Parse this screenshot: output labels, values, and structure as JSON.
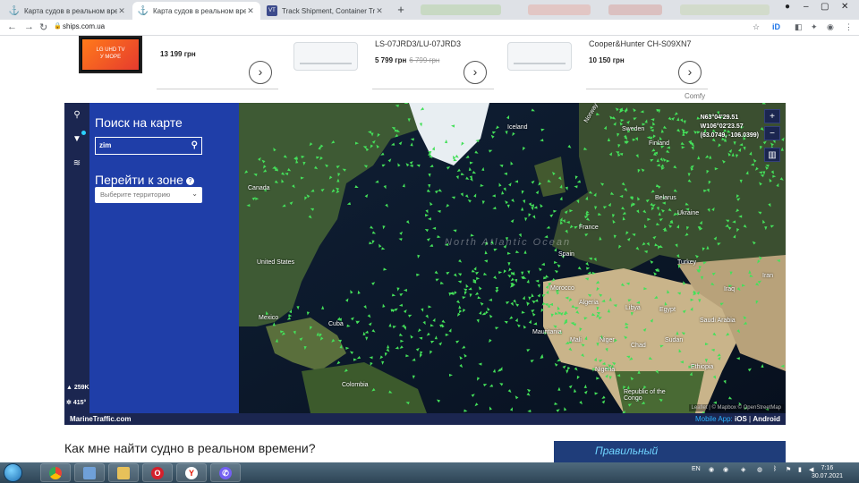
{
  "browser": {
    "tabs": [
      {
        "title": "Карта судов в реальном времени",
        "active": false,
        "icon": "anchor-icon"
      },
      {
        "title": "Карта судов в реальном времени",
        "active": true,
        "icon": "anchor-icon"
      },
      {
        "title": "Track Shipment, Container Tracking",
        "active": false,
        "icon": "vesseltracker-icon"
      }
    ],
    "url": "ships.com.ua"
  },
  "products": [
    {
      "price": "13 199 грн",
      "old_price": ""
    },
    {
      "name": "LS-07JRD3/LU-07JRD3",
      "price": "5 799 грн",
      "old_price": "6 799 грн"
    },
    {
      "name": "Cooper&Hunter CH-S09XN7",
      "price": "10 150 грн",
      "old_price": ""
    }
  ],
  "tv_promo": {
    "brand": "LG UHD TV",
    "text": "У МОРЕ"
  },
  "ad_brand": "Comfy",
  "marinetraffic": {
    "search_title": "Поиск на карте",
    "search_value": "zim",
    "zone_title": "Перейти к зоне",
    "zone_placeholder": "Выберите территорию",
    "vessel_count": "259K",
    "online_count": "415",
    "coords": {
      "lat": "N63°04'29.51",
      "lon": "W106°02'23.57",
      "decimal": "(63.0749, -106.0399)"
    },
    "brand": "MarineTraffic.com",
    "mobile_app_label": "Mobile App:",
    "ios": "iOS",
    "android": "Android",
    "attribution": "Leaflet | © Mapbox © OpenStreetMap",
    "map_labels": {
      "canada": "Canada",
      "usa": "United States",
      "mexico": "Mexico",
      "cuba": "Cuba",
      "colombia": "Colombia",
      "iceland": "Iceland",
      "norway": "Norway",
      "sweden": "Sweden",
      "finland": "Finland",
      "belarus": "Belarus",
      "ukraine": "Ukraine",
      "france": "France",
      "spain": "Spain",
      "morocco": "Morocco",
      "algeria": "Algeria",
      "libya": "Libya",
      "egypt": "Egypt",
      "mali": "Mali",
      "niger": "Niger",
      "chad": "Chad",
      "sudan": "Sudan",
      "mauritania": "Mauritania",
      "nigeria": "Nigeria",
      "ethiopia": "Ethiopia",
      "turkey": "Turkey",
      "iraq": "Iraq",
      "iran": "Iran",
      "saudi": "Saudi Arabia",
      "congo": "Republic of the Congo",
      "atlantic": "North Atlantic Ocean"
    }
  },
  "article_heading": "Как мне найти судно в реальном времени?",
  "ad_banner_text": "Правильный",
  "taskbar": {
    "lang": "EN",
    "time": "7:16",
    "date": "30.07.2021"
  },
  "colors": {
    "panel_blue": "#1f3ea8",
    "dark_navy": "#1b2650",
    "ship_green": "#44e05a"
  }
}
